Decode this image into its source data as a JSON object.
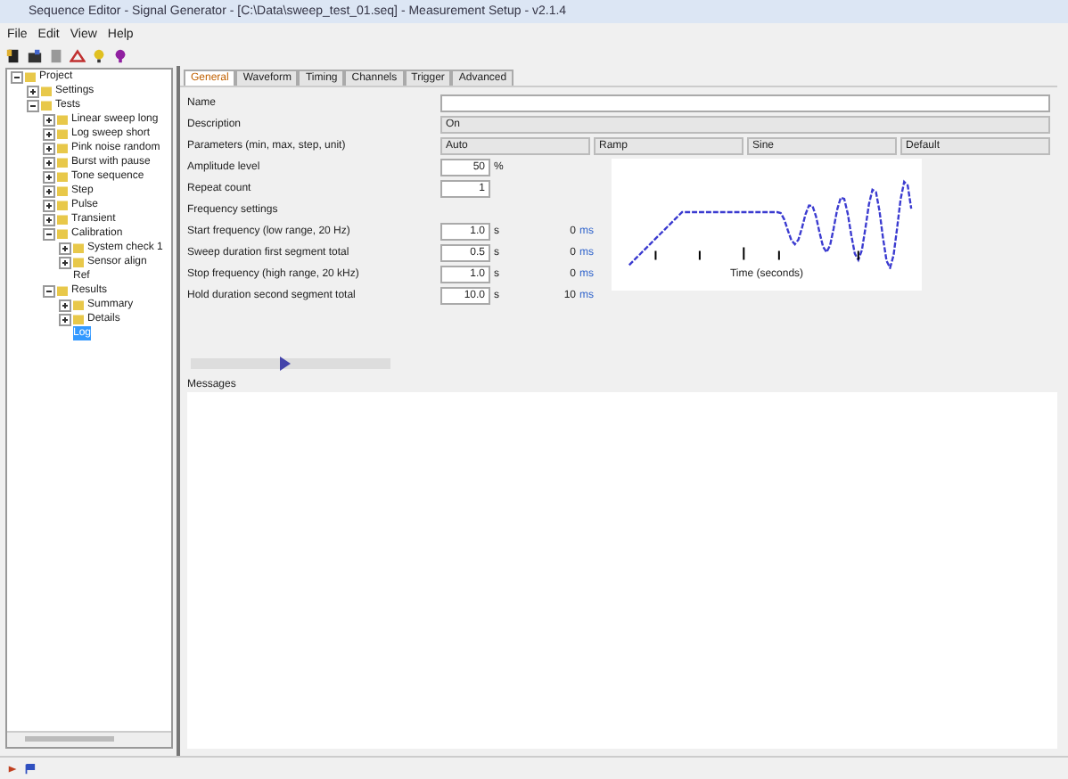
{
  "window": {
    "title": "Sequence Editor - Signal Generator - [C:\\Data\\sweep_test_01.seq] - Measurement Setup - v2.1.4"
  },
  "menu": [
    "File",
    "Edit",
    "View",
    "Help"
  ],
  "tree": [
    {
      "label": "Project",
      "expanded": true,
      "selected": false,
      "children": [
        {
          "label": "Settings",
          "expanded": false,
          "selected": false
        },
        {
          "label": "Tests",
          "expanded": true,
          "selected": false,
          "children": [
            {
              "label": "Linear sweep long",
              "expanded": false,
              "selected": false
            },
            {
              "label": "Log sweep short",
              "expanded": false,
              "selected": false
            },
            {
              "label": "Pink noise random",
              "expanded": false,
              "selected": false
            },
            {
              "label": "Burst with pause",
              "expanded": false,
              "selected": false
            },
            {
              "label": "Tone sequence",
              "expanded": false,
              "selected": false
            },
            {
              "label": "Step",
              "expanded": false,
              "selected": false
            },
            {
              "label": "Pulse",
              "expanded": false,
              "selected": false
            },
            {
              "label": "Transient",
              "expanded": false,
              "selected": false
            },
            {
              "label": "Calibration",
              "expanded": true,
              "selected": false,
              "children": [
                {
                  "label": "System check 1",
                  "expanded": false,
                  "selected": false
                },
                {
                  "label": "Sensor align",
                  "expanded": false,
                  "selected": false
                },
                {
                  "label": "Ref",
                  "selected": false
                }
              ]
            },
            {
              "label": "Results",
              "expanded": true,
              "selected": false,
              "children": [
                {
                  "label": "Summary",
                  "expanded": false,
                  "selected": false
                },
                {
                  "label": "Details",
                  "expanded": false,
                  "selected": false
                },
                {
                  "label": "Log",
                  "selected": true
                }
              ]
            }
          ]
        }
      ]
    }
  ],
  "tabs": [
    {
      "label": "General",
      "selected": true
    },
    {
      "label": "Waveform",
      "selected": false
    },
    {
      "label": "Timing",
      "selected": false
    },
    {
      "label": "Channels",
      "selected": false
    },
    {
      "label": "Trigger",
      "selected": false
    },
    {
      "label": "Advanced",
      "selected": false
    }
  ],
  "form": {
    "name_label": "Name",
    "description_label": "Description",
    "description_value": "On",
    "params_label": "Parameters (min, max, step, unit)",
    "params": [
      "Auto",
      "Ramp",
      "Sine",
      "Default"
    ],
    "amplitude_label": "Amplitude level",
    "amplitude_value": "50",
    "amplitude_unit": "%",
    "repeat_label": "Repeat count",
    "repeat_value": "1",
    "section_label": "Frequency settings",
    "rows": [
      {
        "label": "Start frequency (low range, 20 Hz)",
        "value": "1.0",
        "unit": "s",
        "value2": "0",
        "unit2": "ms"
      },
      {
        "label": "Sweep duration first segment total",
        "value": "0.5",
        "unit": "s",
        "value2": "0",
        "unit2": "ms"
      },
      {
        "label": "Stop frequency (high range, 20 kHz)",
        "value": "1.0",
        "unit": "s",
        "value2": "0",
        "unit2": "ms"
      },
      {
        "label": "Hold duration second segment total",
        "value": "10.0",
        "unit": "s",
        "value2": "10",
        "unit2": "ms"
      }
    ]
  },
  "preview": {
    "axis_label": "Time (seconds)"
  },
  "slider": {
    "level": 0.45
  },
  "messages": {
    "label": "Messages"
  }
}
